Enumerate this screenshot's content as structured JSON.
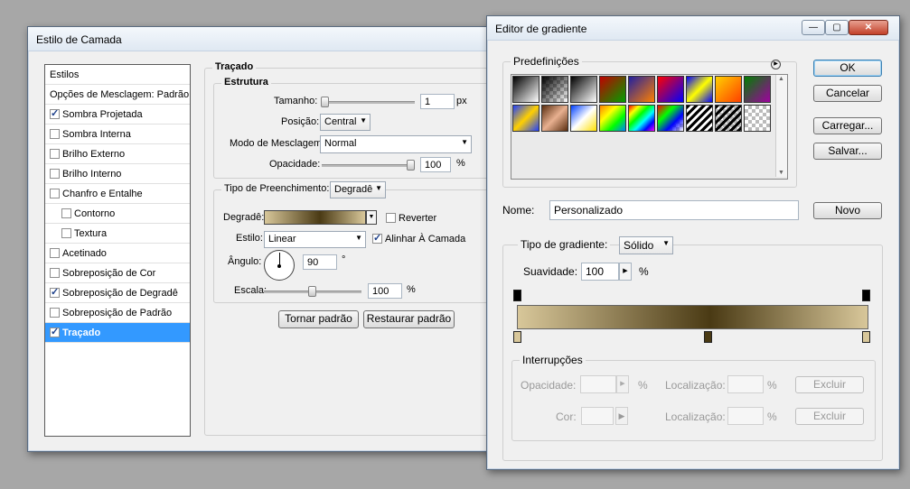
{
  "colors": {
    "selection": "#3399ff",
    "gradient_dark": "#4a3a14",
    "gradient_light": "#d8c79a"
  },
  "layer_style": {
    "title": "Estilo de Camada",
    "sidebar": [
      {
        "label": "Estilos",
        "checkbox": null,
        "indent": 0,
        "selected": false
      },
      {
        "label": "Opções de Mesclagem: Padrão",
        "checkbox": null,
        "indent": 0,
        "selected": false
      },
      {
        "label": "Sombra Projetada",
        "checkbox": true,
        "indent": 0,
        "selected": false
      },
      {
        "label": "Sombra Interna",
        "checkbox": false,
        "indent": 0,
        "selected": false
      },
      {
        "label": "Brilho Externo",
        "checkbox": false,
        "indent": 0,
        "selected": false
      },
      {
        "label": "Brilho Interno",
        "checkbox": false,
        "indent": 0,
        "selected": false
      },
      {
        "label": "Chanfro e Entalhe",
        "checkbox": false,
        "indent": 0,
        "selected": false
      },
      {
        "label": "Contorno",
        "checkbox": false,
        "indent": 1,
        "selected": false
      },
      {
        "label": "Textura",
        "checkbox": false,
        "indent": 1,
        "selected": false
      },
      {
        "label": "Acetinado",
        "checkbox": false,
        "indent": 0,
        "selected": false
      },
      {
        "label": "Sobreposição de Cor",
        "checkbox": false,
        "indent": 0,
        "selected": false
      },
      {
        "label": "Sobreposição de Degradê",
        "checkbox": true,
        "indent": 0,
        "selected": false
      },
      {
        "label": "Sobreposição de Padrão",
        "checkbox": false,
        "indent": 0,
        "selected": false
      },
      {
        "label": "Traçado",
        "checkbox": true,
        "indent": 0,
        "selected": true
      }
    ],
    "tracado": {
      "heading": "Traçado",
      "estrutura": {
        "heading": "Estrutura",
        "tamanho_label": "Tamanho:",
        "tamanho_value": "1",
        "tamanho_unit": "px",
        "tamanho_level": 0.0,
        "posicao_label": "Posição:",
        "posicao_value": "Central",
        "modo_label": "Modo de Mesclagem:",
        "modo_value": "Normal",
        "opacidade_label": "Opacidade:",
        "opacidade_value": "100",
        "opacidade_unit": "%",
        "opacidade_level": 1.0
      },
      "fill": {
        "tipo_label": "Tipo de Preenchimento:",
        "tipo_value": "Degradê",
        "degrade_label": "Degradê:",
        "reverter_label": "Reverter",
        "reverter_checked": false,
        "estilo_label": "Estilo:",
        "estilo_value": "Linear",
        "alinhar_label": "Alinhar À Camada",
        "alinhar_checked": true,
        "angulo_label": "Ângulo:",
        "angulo_value": "90",
        "angulo_unit": "°",
        "escala_label": "Escala:",
        "escala_value": "100",
        "escala_unit": "%",
        "escala_level": 0.5
      },
      "tornar_padrao": "Tornar padrão",
      "restaurar_padrao": "Restaurar padrão"
    }
  },
  "gradient_editor": {
    "title": "Editor de gradiente",
    "predefinicoes_label": "Predefinições",
    "ok": "OK",
    "cancelar": "Cancelar",
    "carregar": "Carregar...",
    "salvar": "Salvar...",
    "nome_label": "Nome:",
    "nome_value": "Personalizado",
    "novo": "Novo",
    "tipo_label": "Tipo de gradiente:",
    "tipo_value": "Sólido",
    "suavidade_label": "Suavidade:",
    "suavidade_value": "100",
    "suavidade_unit": "%",
    "interrupcoes_label": "Interrupções",
    "opacidade_label": "Opacidade:",
    "opacidade_unit": "%",
    "localizacao_label": "Localização:",
    "localizacao_unit": "%",
    "cor_label": "Cor:",
    "excluir": "Excluir"
  }
}
